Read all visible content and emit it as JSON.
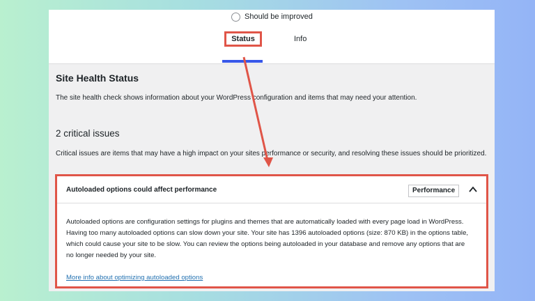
{
  "header": {
    "health_rating_label": "Should be improved",
    "tabs": [
      {
        "label": "Status",
        "active": true
      },
      {
        "label": "Info",
        "active": false
      }
    ]
  },
  "main": {
    "title": "Site Health Status",
    "description": "The site health check shows information about your WordPress configuration and items that may need your attention.",
    "issues_heading": "2 critical issues",
    "issues_description": "Critical issues are items that may have a high impact on your sites performance or security, and resolving these issues should be prioritized."
  },
  "issue": {
    "title": "Autoloaded options could affect performance",
    "badge": "Performance",
    "body": "Autoloaded options are configuration settings for plugins and themes that are automatically loaded with every page load in WordPress. Having too many autoloaded options can slow down your site. Your site has 1396 autoloaded options (size: 870 KB) in the options table, which could cause your site to be slow. You can review the options being autoloaded in your database and remove any options that are no longer needed by your site.",
    "link": "More info about optimizing autoloaded options"
  },
  "colors": {
    "highlight": "#e05548",
    "tab_underline": "#3858e9",
    "link": "#2271b1"
  }
}
